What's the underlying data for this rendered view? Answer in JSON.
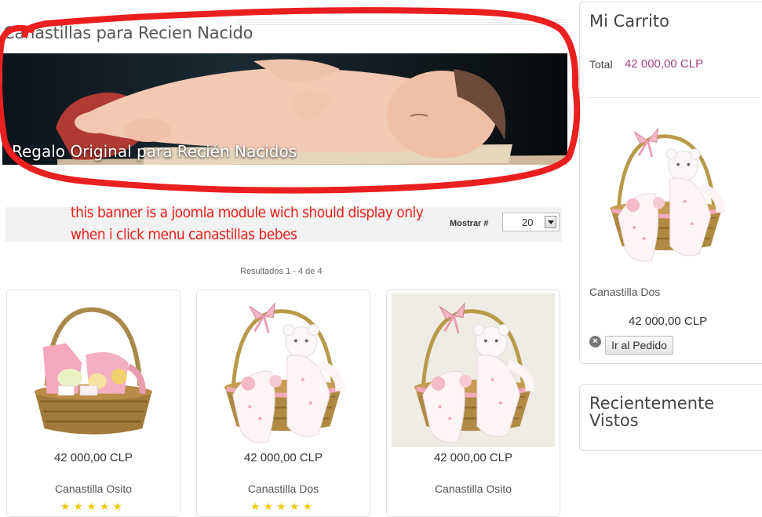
{
  "page": {
    "title": "Canastillas para Recien Nacido"
  },
  "banner": {
    "caption": "Regalo Original para Recién Nacidos"
  },
  "annotation": {
    "line1": "this banner is a joomla module wich should display only",
    "line2": "when i click menu canastillas bebes",
    "color": "#e8201c"
  },
  "toolbar": {
    "show_label": "Mostrar #",
    "show_value": "20"
  },
  "results": {
    "text": "Resultados 1 - 4 de 4"
  },
  "products": [
    {
      "price": "42 000,00 CLP",
      "name": "Canastilla Osito",
      "stars": "★★★★★",
      "image": "basket-clothes-image"
    },
    {
      "price": "42 000,00 CLP",
      "name": "Canastilla Dos",
      "stars": "★★★★★",
      "image": "basket-teddy-image"
    },
    {
      "price": "42 000,00 CLP",
      "name": "Canastilla Osito",
      "stars": "",
      "image": "basket-teddy-image"
    }
  ],
  "cart": {
    "title": "Mi Carrito",
    "total_label": "Total",
    "total_value": "42 000,00 CLP",
    "item_name": "Canastilla Dos",
    "item_price": "42 000,00 CLP",
    "order_button": "Ir al Pedido",
    "accent_color": "#a6417f"
  },
  "recent": {
    "title": "Recientemente Vistos"
  }
}
